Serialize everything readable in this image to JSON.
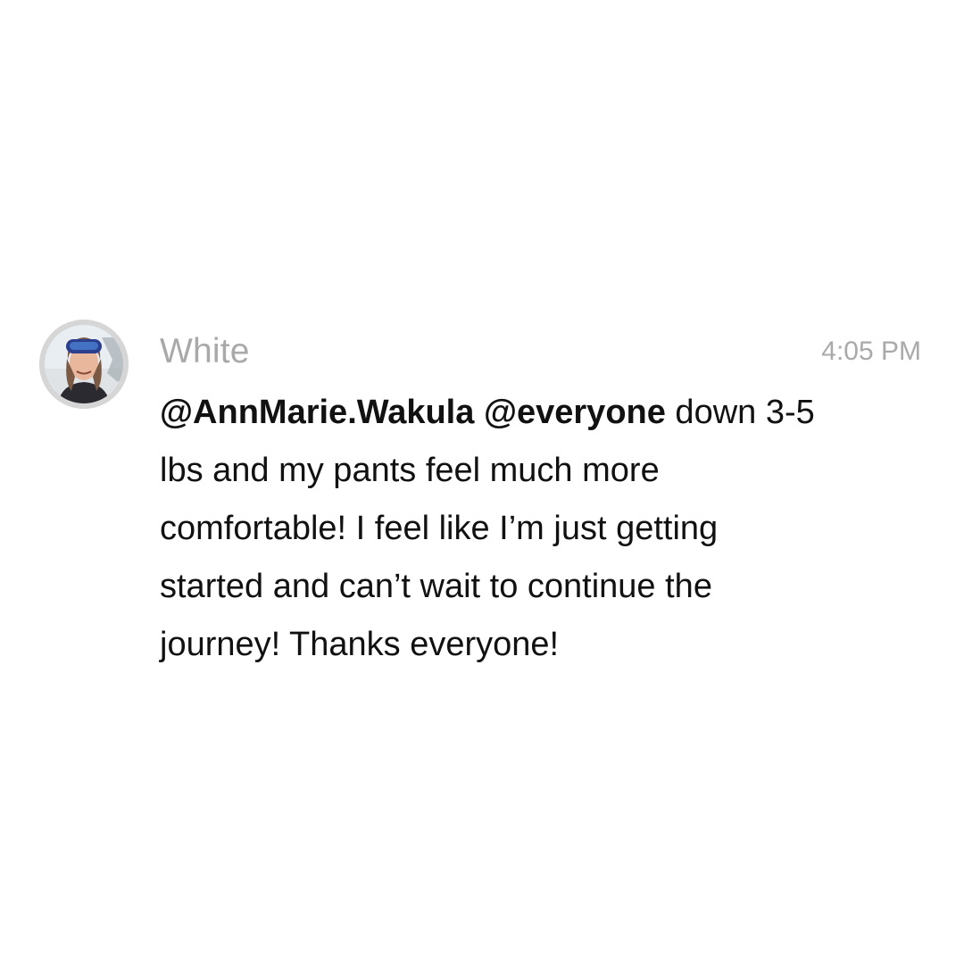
{
  "message": {
    "sender": "White",
    "time": "4:05 PM",
    "mentions": [
      "@AnnMarie.Wakula",
      "@everyone"
    ],
    "body_lines": [
      " down 3-5",
      "lbs and my pants feel much more",
      "comfortable! I feel like I’m just getting",
      "started and can’t wait to continue the",
      "journey! Thanks everyone!"
    ]
  },
  "avatar": {
    "icon": "user-photo-avatar",
    "colors": {
      "ring": "#d6d6d6",
      "sky": "#e9eef3",
      "goggles": "#2c3f8f",
      "skin": "#e8b79c",
      "jacket": "#2a2a30"
    }
  },
  "colors": {
    "background": "#ffffff",
    "meta_text": "#a9a9a9",
    "body_text": "#111111"
  }
}
